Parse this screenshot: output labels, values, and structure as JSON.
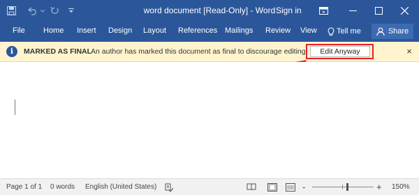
{
  "titlebar": {
    "title": "word document [Read-Only]  -  Word",
    "signin": "Sign in",
    "icons": [
      "save-icon",
      "undo-icon",
      "redo-icon",
      "customize-qat-icon",
      "ribbon-display-icon",
      "minimize-icon",
      "maximize-icon",
      "close-icon"
    ]
  },
  "ribbon": {
    "tabs": [
      "File",
      "Home",
      "Insert",
      "Design",
      "Layout",
      "References",
      "Mailings",
      "Review",
      "View"
    ],
    "tellme": "Tell me",
    "share": "Share"
  },
  "message_bar": {
    "title": "MARKED AS FINAL",
    "text": "An author has marked this document as final to discourage editing.",
    "button": "Edit Anyway",
    "close": "×"
  },
  "status": {
    "page": "Page 1 of 1",
    "words": "0 words",
    "language": "English (United States)",
    "zoom": "150%",
    "zoom_minus": "-",
    "zoom_plus": "+"
  },
  "colors": {
    "brand": "#2b579a",
    "message_bar": "#fff4ce",
    "highlight": "#e8202a"
  }
}
